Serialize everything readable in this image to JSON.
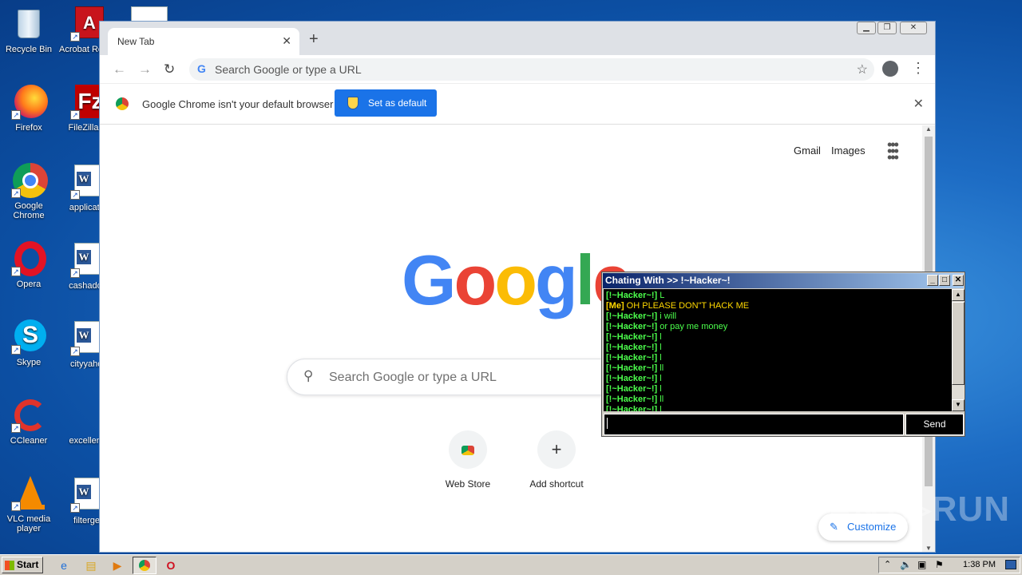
{
  "desktop": {
    "icons": [
      {
        "label": "Recycle Bin",
        "icon": "recycle-bin-icon"
      },
      {
        "label": "Acrobat Reader",
        "icon": "acrobat-icon"
      },
      {
        "label": "Firefox",
        "icon": "firefox-icon"
      },
      {
        "label": "FileZilla C",
        "icon": "filezilla-icon"
      },
      {
        "label": "Google Chrome",
        "icon": "chrome-icon"
      },
      {
        "label": "applicatio",
        "icon": "word-doc-icon"
      },
      {
        "label": "Opera",
        "icon": "opera-icon"
      },
      {
        "label": "cashadde",
        "icon": "word-doc-icon"
      },
      {
        "label": "Skype",
        "icon": "skype-icon"
      },
      {
        "label": "cityyahor",
        "icon": "word-doc-icon"
      },
      {
        "label": "CCleaner",
        "icon": "ccleaner-icon"
      },
      {
        "label": "excellentr",
        "icon": "doc-icon"
      },
      {
        "label": "VLC media player",
        "icon": "vlc-icon"
      },
      {
        "label": "filterget",
        "icon": "word-doc-icon"
      }
    ]
  },
  "browser": {
    "tab_title": "New Tab",
    "tab_close": "✕",
    "new_tab": "+",
    "omnibox_placeholder": "Search Google or type a URL",
    "infobar_text": "Google Chrome isn't your default browser",
    "set_default_label": "Set as default",
    "infobar_close": "✕",
    "links": {
      "gmail": "Gmail",
      "images": "Images"
    },
    "logo": "Google",
    "search_placeholder": "Search Google or type a URL",
    "shortcuts": [
      {
        "label": "Web Store",
        "icon": "web-store-icon"
      },
      {
        "label": "Add shortcut",
        "icon": "plus-icon"
      }
    ],
    "customize_label": "Customize"
  },
  "chat": {
    "title": "Chating With >> !~Hacker~!",
    "send_label": "Send",
    "messages": [
      {
        "sender": "[!~Hacker~!]",
        "text": "L",
        "me": false
      },
      {
        "sender": "[Me]",
        "text": "OH PLEASE DON\"T HACK ME",
        "me": true
      },
      {
        "sender": "[!~Hacker~!]",
        "text": "i will",
        "me": false
      },
      {
        "sender": "[!~Hacker~!]",
        "text": "or pay me money",
        "me": false
      },
      {
        "sender": "[!~Hacker~!]",
        "text": "l",
        "me": false
      },
      {
        "sender": "[!~Hacker~!]",
        "text": "l",
        "me": false
      },
      {
        "sender": "[!~Hacker~!]",
        "text": "l",
        "me": false
      },
      {
        "sender": "[!~Hacker~!]",
        "text": "ll",
        "me": false
      },
      {
        "sender": "[!~Hacker~!]",
        "text": "l",
        "me": false
      },
      {
        "sender": "[!~Hacker~!]",
        "text": "l",
        "me": false
      },
      {
        "sender": "[!~Hacker~!]",
        "text": "ll",
        "me": false
      },
      {
        "sender": "[!~Hacker~!]",
        "text": "l",
        "me": false
      }
    ]
  },
  "watermark": "ANY.RUN",
  "taskbar": {
    "start_label": "Start",
    "clock": "1:38 PM"
  }
}
